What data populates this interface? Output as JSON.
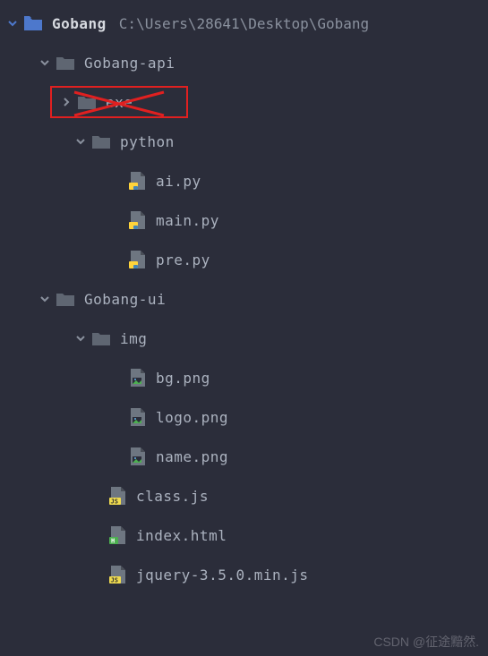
{
  "root": {
    "name": "Gobang",
    "path": "C:\\Users\\28641\\Desktop\\Gobang"
  },
  "tree": {
    "gobang_api": "Gobang-api",
    "exe": "exe",
    "python": "python",
    "ai_py": "ai.py",
    "main_py": "main.py",
    "pre_py": "pre.py",
    "gobang_ui": "Gobang-ui",
    "img": "img",
    "bg_png": "bg.png",
    "logo_png": "logo.png",
    "name_png": "name.png",
    "class_js": "class.js",
    "index_html": "index.html",
    "jquery_js": "jquery-3.5.0.min.js"
  },
  "watermark": "CSDN @征途黯然."
}
